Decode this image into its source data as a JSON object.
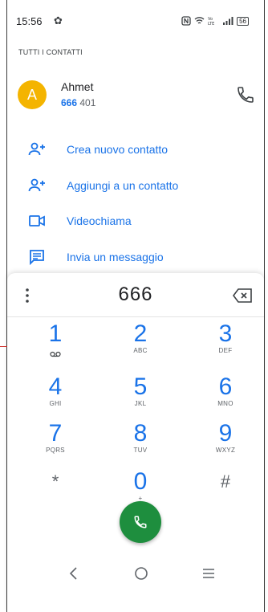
{
  "status": {
    "time": "15:56",
    "battery": "56"
  },
  "section_header": "TUTTI I CONTATTI",
  "contact": {
    "initial": "A",
    "name": "Ahmet",
    "number_match": "666",
    "number_rest": " 401",
    "avatar_color": "#f4b400"
  },
  "actions": [
    {
      "label": "Crea nuovo contatto",
      "icon": "add-person-icon"
    },
    {
      "label": "Aggiungi a un contatto",
      "icon": "add-person-icon"
    },
    {
      "label": "Videochiama",
      "icon": "video-icon"
    },
    {
      "label": "Invia un messaggio",
      "icon": "message-icon"
    }
  ],
  "dialpad": {
    "entered": "666",
    "keys": [
      {
        "digit": "1",
        "letters": ""
      },
      {
        "digit": "2",
        "letters": "ABC"
      },
      {
        "digit": "3",
        "letters": "DEF"
      },
      {
        "digit": "4",
        "letters": "GHI"
      },
      {
        "digit": "5",
        "letters": "JKL"
      },
      {
        "digit": "6",
        "letters": "MNO"
      },
      {
        "digit": "7",
        "letters": "PQRS"
      },
      {
        "digit": "8",
        "letters": "TUV"
      },
      {
        "digit": "9",
        "letters": "WXYZ"
      },
      {
        "digit": "*",
        "letters": ""
      },
      {
        "digit": "0",
        "letters": "+"
      },
      {
        "digit": "#",
        "letters": ""
      }
    ]
  },
  "colors": {
    "accent": "#1a73e8",
    "call": "#1e8e3e",
    "callout": "#d0312d"
  }
}
